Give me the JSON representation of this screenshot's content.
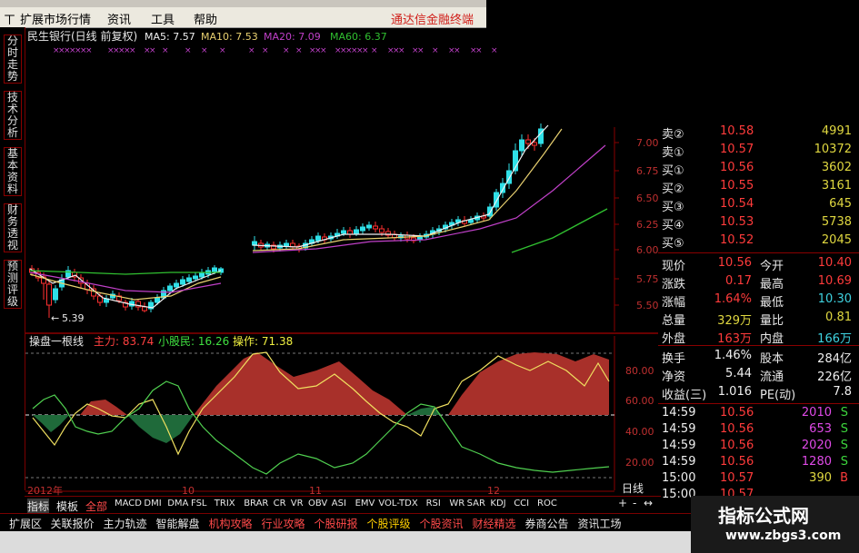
{
  "menu": {
    "items": [
      "扩展市场行情",
      "资讯",
      "工具",
      "帮助"
    ],
    "brand": "通达信金融终端"
  },
  "left_nav": [
    "分时走势",
    "技术分析",
    "基本资料",
    "财务透视",
    "预测评级"
  ],
  "chart": {
    "title": "民生银行(日线 前复权)",
    "ma5_label": "MA5: 7.57",
    "ma10_label": "MA10: 7.53",
    "ma20_label": "MA20: 7.09",
    "ma60_label": "MA60: 6.37",
    "low_marker": "5.39",
    "price_ticks": [
      "7.00",
      "6.75",
      "6.50",
      "6.25",
      "6.00",
      "5.75",
      "5.50"
    ],
    "indicator_name": "操盘一根线",
    "ind_main": "主力: 83.74",
    "ind_retail": "小股民: 16.26",
    "ind_op": "操作: 71.38",
    "ind_ticks": [
      "80.00",
      "60.00",
      "40.00",
      "20.00"
    ],
    "x_labels": [
      "2012年",
      "10",
      "11",
      "12"
    ],
    "period": "日线"
  },
  "colors": {
    "up": "#ff3030",
    "down": "#2fe0e8",
    "ma5": "#f0f0f0",
    "ma10": "#e8d070",
    "ma20": "#c040c8",
    "ma60": "#30c030",
    "fill_red": "#a8302a",
    "fill_green": "#1f6a3a"
  },
  "order_book": [
    {
      "label": "卖②",
      "price": "10.58",
      "vol": "4991"
    },
    {
      "label": "卖①",
      "price": "10.57",
      "vol": "10372"
    },
    {
      "label": "买①",
      "price": "10.56",
      "vol": "3602"
    },
    {
      "label": "买②",
      "price": "10.55",
      "vol": "3161"
    },
    {
      "label": "买③",
      "price": "10.54",
      "vol": "645"
    },
    {
      "label": "买④",
      "price": "10.53",
      "vol": "5738"
    },
    {
      "label": "买⑤",
      "price": "10.52",
      "vol": "2045"
    }
  ],
  "quote": [
    {
      "l1": "现价",
      "v1": "10.56",
      "l2": "今开",
      "v2": "10.40"
    },
    {
      "l1": "涨跌",
      "v1": "0.17",
      "l2": "最高",
      "v2": "10.69"
    },
    {
      "l1": "涨幅",
      "v1": "1.64%",
      "l2": "最低",
      "v2": "10.30"
    },
    {
      "l1": "总量",
      "v1": "329万",
      "l2": "量比",
      "v2": "0.81"
    },
    {
      "l1": "外盘",
      "v1": "163万",
      "l2": "内盘",
      "v2": "166万"
    }
  ],
  "fundamentals": [
    {
      "l1": "换手",
      "v1": "1.46%",
      "l2": "股本",
      "v2": "284亿"
    },
    {
      "l1": "净资",
      "v1": "5.44",
      "l2": "流通",
      "v2": "226亿"
    },
    {
      "l1": "收益(三)",
      "v1": "1.016",
      "l2": "PE(动)",
      "v2": "7.8"
    }
  ],
  "ticks": [
    {
      "time": "14:59",
      "price": "10.56",
      "vol": "2010",
      "flag": "S"
    },
    {
      "time": "14:59",
      "price": "10.56",
      "vol": "653",
      "flag": "S"
    },
    {
      "time": "14:59",
      "price": "10.56",
      "vol": "2020",
      "flag": "S"
    },
    {
      "time": "14:59",
      "price": "10.56",
      "vol": "1280",
      "flag": "S"
    },
    {
      "time": "15:00",
      "price": "10.57",
      "vol": "390",
      "flag": "B"
    },
    {
      "time": "15:00",
      "price": "10.57",
      "vol": "",
      "flag": ""
    }
  ],
  "indicator_tabs": [
    "指标",
    "模板",
    "全部",
    "MACD",
    "DMI",
    "DMA",
    "FSL",
    "TRIX",
    "BRAR",
    "CR",
    "VR",
    "OBV",
    "ASI",
    "EMV",
    "VOL-TDX",
    "RSI",
    "WR",
    "SAR",
    "KDJ",
    "CCI",
    "ROC"
  ],
  "zoom_controls": [
    "+",
    "-",
    "↔"
  ],
  "bottom_tabs": [
    "扩展区",
    "关联报价",
    "主力轨迹",
    "智能解盘",
    "机构攻略",
    "行业攻略",
    "个股研报",
    "个股评级",
    "个股资讯",
    "财经精选",
    "券商公告",
    "资讯工场"
  ],
  "bottom_tab_colors": [
    "#e8e8e8",
    "#e8e8e8",
    "#e8e8e8",
    "#e8e8e8",
    "#ff4a4a",
    "#ff4a4a",
    "#ff4a4a",
    "#ffd000",
    "#ff4a4a",
    "#ff4a4a",
    "#e8e8e8",
    "#e8e8e8"
  ],
  "watermark": {
    "line1": "指标公式网",
    "line2": "www.zbgs3.com"
  }
}
